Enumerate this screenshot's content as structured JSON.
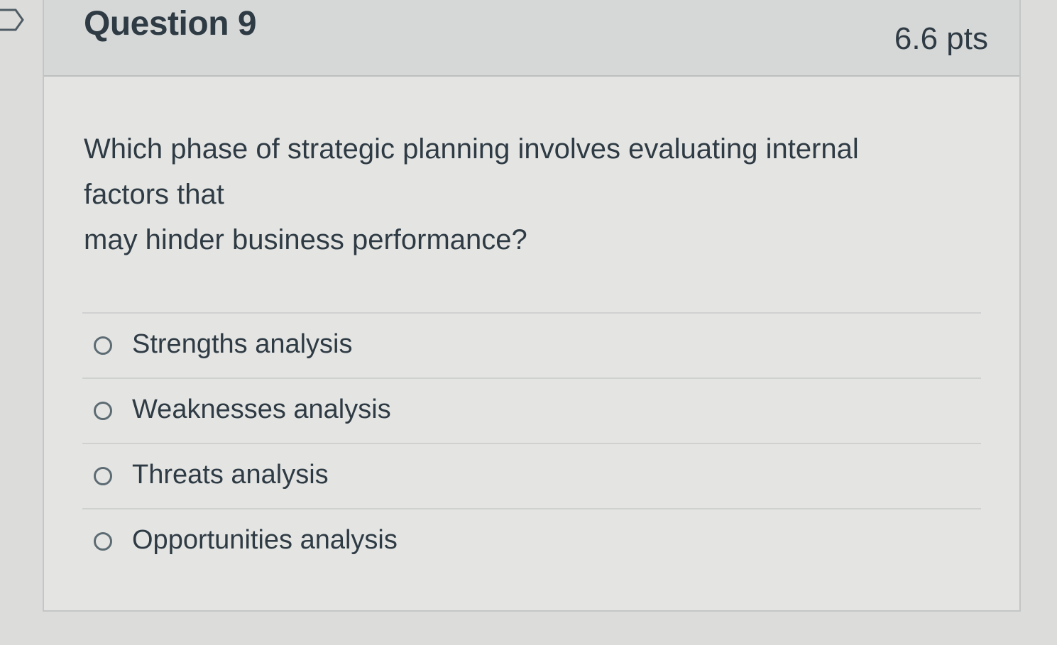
{
  "question": {
    "title": "Question 9",
    "points": "6.6 pts",
    "text_lines": [
      "Which phase of strategic planning involves evaluating internal",
      "factors that",
      "may hinder business performance?"
    ],
    "answers": [
      {
        "label": "Strengths analysis",
        "selected": false
      },
      {
        "label": "Weaknesses analysis",
        "selected": false
      },
      {
        "label": "Threats analysis",
        "selected": false
      },
      {
        "label": "Opportunities analysis",
        "selected": false
      }
    ]
  },
  "icons": {
    "flag": "bookmark-flag-icon",
    "radio": "radio-button-icon"
  },
  "colors": {
    "text": "#2f3b44",
    "header_bg": "#d6d8d7",
    "card_bg": "#e4e5e3",
    "border": "#c4c6c6"
  }
}
